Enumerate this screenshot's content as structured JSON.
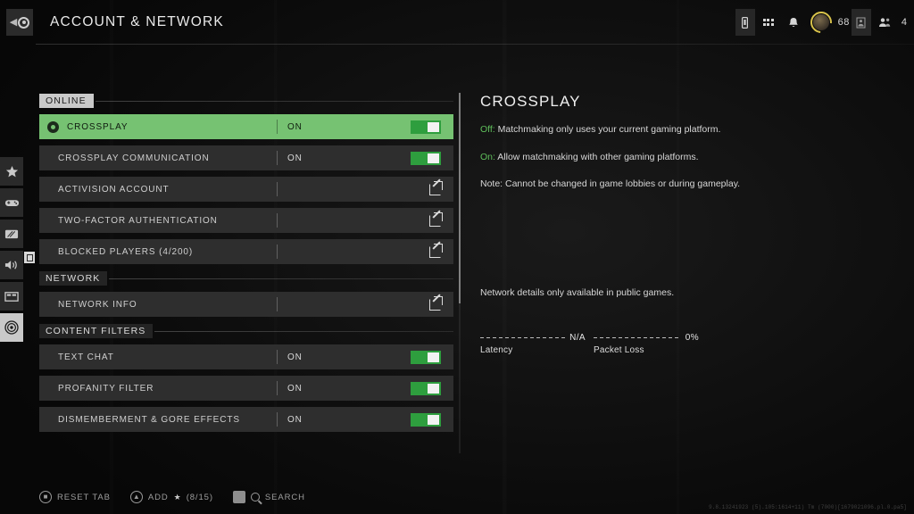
{
  "header": {
    "title": "ACCOUNT & NETWORK",
    "back_icon": "back-circle-icon",
    "icons": [
      {
        "name": "device-icon",
        "glyph": "device"
      },
      {
        "name": "grid-menu-icon",
        "glyph": "grid"
      },
      {
        "name": "notification-bell-icon",
        "glyph": "bell"
      }
    ],
    "player_level": "68",
    "squad_icon": "squad-icon",
    "party_count": "4"
  },
  "rail": {
    "items": [
      {
        "name": "sidebar-item-favorites",
        "icon": "star-icon",
        "active": false
      },
      {
        "name": "sidebar-item-controller",
        "icon": "gamepad-icon",
        "active": false
      },
      {
        "name": "sidebar-item-graphics",
        "icon": "display-icon",
        "active": false
      },
      {
        "name": "sidebar-item-audio",
        "icon": "speaker-icon",
        "active": false
      },
      {
        "name": "sidebar-item-interface",
        "icon": "window-icon",
        "active": false
      },
      {
        "name": "sidebar-item-account-network",
        "icon": "network-radar-icon",
        "active": true
      }
    ]
  },
  "settings": {
    "sections": [
      {
        "label": "ONLINE",
        "style": "light",
        "rows": [
          {
            "label": "CROSSPLAY",
            "value": "ON",
            "control": "toggle",
            "toggle_on": true,
            "selected": true,
            "bullet": true
          },
          {
            "label": "CROSSPLAY COMMUNICATION",
            "value": "ON",
            "control": "toggle",
            "toggle_on": true,
            "selected": false,
            "bullet": false
          },
          {
            "label": "ACTIVISION ACCOUNT",
            "value": "",
            "control": "external-link",
            "selected": false,
            "bullet": false
          },
          {
            "label": "TWO-FACTOR AUTHENTICATION",
            "value": "",
            "control": "external-link",
            "selected": false,
            "bullet": false
          },
          {
            "label": "BLOCKED PLAYERS (4/200)",
            "value": "",
            "control": "external-link",
            "selected": false,
            "bullet": false
          }
        ]
      },
      {
        "label": "NETWORK",
        "style": "dark",
        "rows": [
          {
            "label": "NETWORK INFO",
            "value": "",
            "control": "external-link",
            "selected": false,
            "bullet": false
          }
        ]
      },
      {
        "label": "CONTENT FILTERS",
        "style": "dark",
        "rows": [
          {
            "label": "TEXT CHAT",
            "value": "ON",
            "control": "toggle",
            "toggle_on": true,
            "selected": false,
            "bullet": false
          },
          {
            "label": "PROFANITY FILTER",
            "value": "ON",
            "control": "toggle",
            "toggle_on": true,
            "selected": false,
            "bullet": false
          },
          {
            "label": "DISMEMBERMENT & GORE EFFECTS",
            "value": "ON",
            "control": "toggle",
            "toggle_on": true,
            "selected": false,
            "bullet": false
          }
        ]
      }
    ]
  },
  "detail": {
    "title": "CROSSPLAY",
    "lines": [
      {
        "key": "Off:",
        "text": " Matchmaking only uses your current gaming platform."
      },
      {
        "key": "On:",
        "text": " Allow matchmaking with other gaming platforms."
      },
      {
        "key": "",
        "text": "Note: Cannot be changed in game lobbies or during gameplay."
      }
    ],
    "network_note": "Network details only available in public games.",
    "meters": [
      {
        "name": "Latency",
        "value": "N/A"
      },
      {
        "name": "Packet Loss",
        "value": "0%"
      }
    ]
  },
  "footer": {
    "reset_tab": "RESET TAB",
    "add": "ADD",
    "add_count": "(8/15)",
    "search": "SEARCH",
    "version": "9.8.13241923 (5).105:1614+11) Tm (7000)[1679021096.pl.0.pa5]"
  },
  "colors": {
    "accent_green": "#76c272",
    "toggle_green": "#2e9e3e",
    "row_bg": "#2e2e2e",
    "panel_bg": "#0e0e0e"
  }
}
